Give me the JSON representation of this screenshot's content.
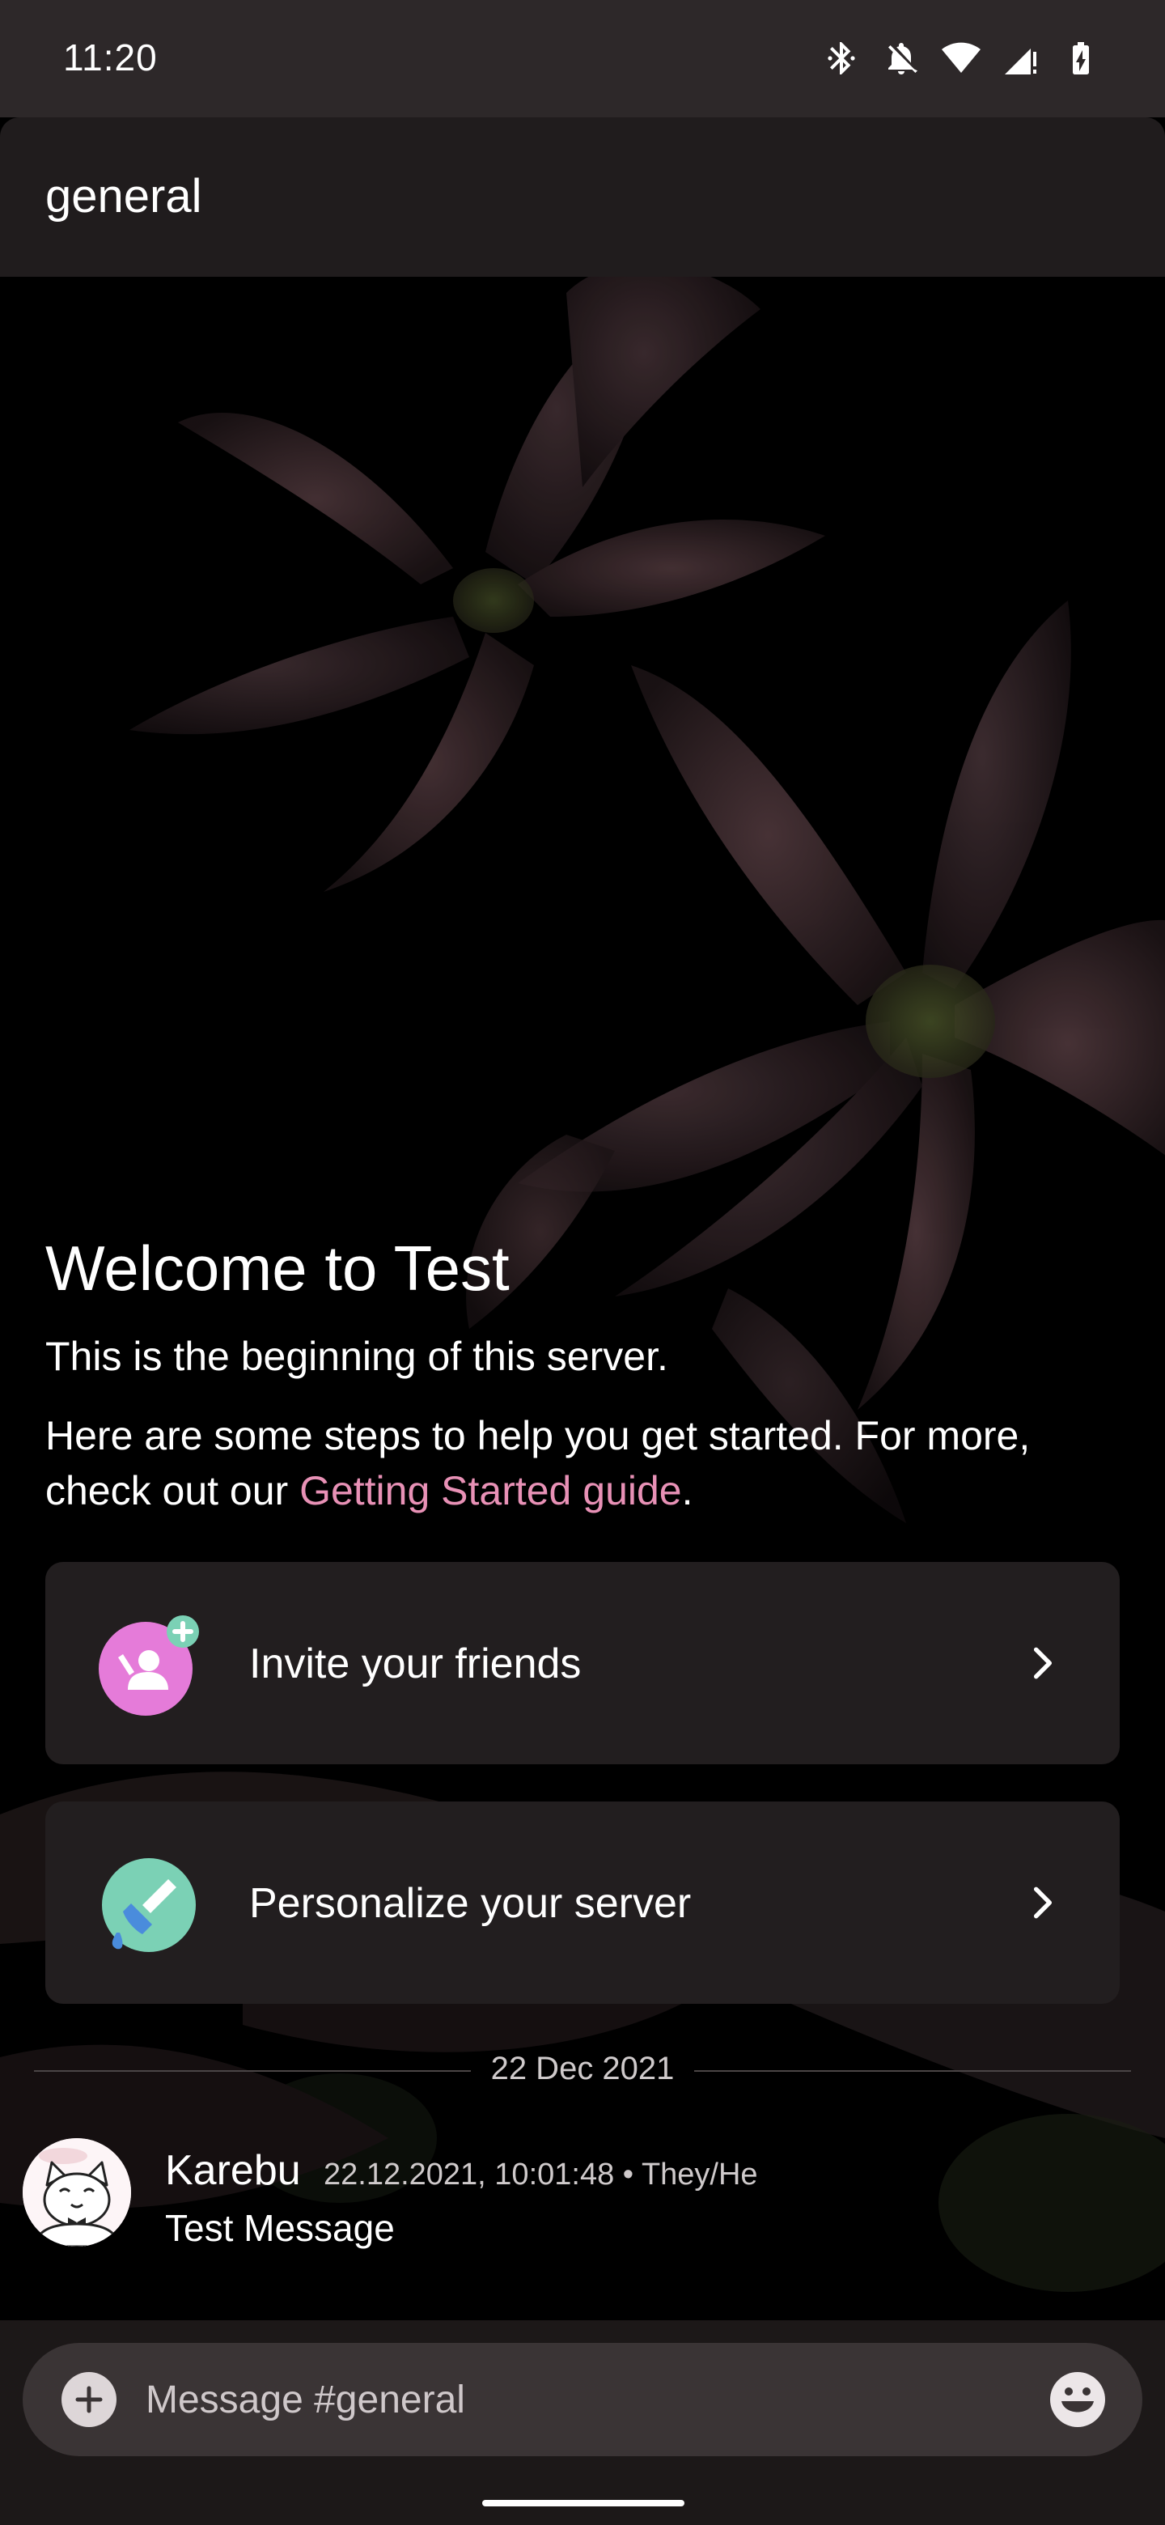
{
  "status_bar": {
    "time": "11:20",
    "icons": [
      "bluetooth-icon",
      "notifications-off-icon",
      "wifi-icon",
      "signal-icon",
      "battery-charging-icon"
    ]
  },
  "channel": {
    "name": "general"
  },
  "welcome": {
    "title": "Welcome to Test",
    "subtitle": "This is the beginning of this server.",
    "steps_text": "Here are some steps to help you get started. For more, check out our ",
    "guide_link": "Getting Started guide",
    "steps_end": "."
  },
  "cards": [
    {
      "label": "Invite your friends",
      "icon": "invite-friends-icon",
      "color": "#e57bd9"
    },
    {
      "label": "Personalize your server",
      "icon": "paintbrush-icon",
      "color": "#7bd1b5"
    }
  ],
  "divider": {
    "date": "22 Dec 2021"
  },
  "message": {
    "author": "Karebu",
    "meta": "22.12.2021, 10:01:48 • They/He",
    "text": "Test Message"
  },
  "composer": {
    "placeholder": "Message #general",
    "add_icon": "add-icon",
    "emoji_icon": "emoji-icon"
  },
  "colors": {
    "link": "#e891b6",
    "card_bg": "#221e1f",
    "header_bg": "#201c1d"
  }
}
